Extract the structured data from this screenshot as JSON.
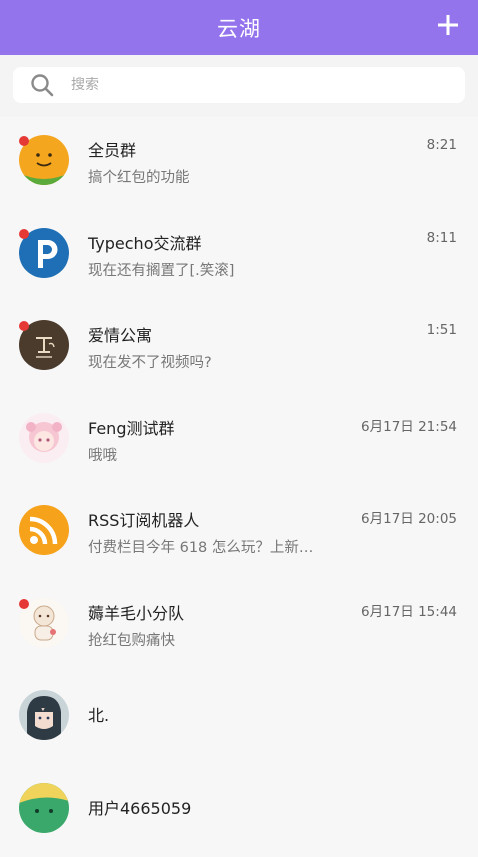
{
  "header": {
    "title": "云湖",
    "add_icon": "plus-icon"
  },
  "search": {
    "placeholder": "搜索",
    "icon": "search-icon"
  },
  "colors": {
    "accent": "#9474ed",
    "unread_dot": "#e53935"
  },
  "chats": [
    {
      "name": "全员群",
      "message": "搞个红包的功能",
      "time": "8:21",
      "unread": true,
      "avatar": "smiley-avatar"
    },
    {
      "name": "Typecho交流群",
      "message": "现在还有搁置了[.笑滚]",
      "time": "8:11",
      "unread": true,
      "avatar": "typecho-logo-avatar"
    },
    {
      "name": "爱情公寓",
      "message": "现在发不了视频吗?",
      "time": "1:51",
      "unread": true,
      "avatar": "brown-logo-avatar"
    },
    {
      "name": "Feng测试群",
      "message": "哦哦",
      "time": "6月17日 21:54",
      "unread": false,
      "avatar": "anime-girl-avatar"
    },
    {
      "name": "RSS订阅机器人",
      "message": "付费栏目今年 618 怎么玩？上新…",
      "time": "6月17日 20:05",
      "unread": false,
      "avatar": "rss-avatar"
    },
    {
      "name": "薅羊毛小分队",
      "message": "抢红包购痛快",
      "time": "6月17日 15:44",
      "unread": true,
      "avatar": "sheep-avatar"
    },
    {
      "name": "北.",
      "message": "",
      "time": "",
      "unread": false,
      "avatar": "anime-boy-avatar"
    },
    {
      "name": "用户4665059",
      "message": "",
      "time": "",
      "unread": false,
      "avatar": "green-blob-avatar"
    }
  ]
}
